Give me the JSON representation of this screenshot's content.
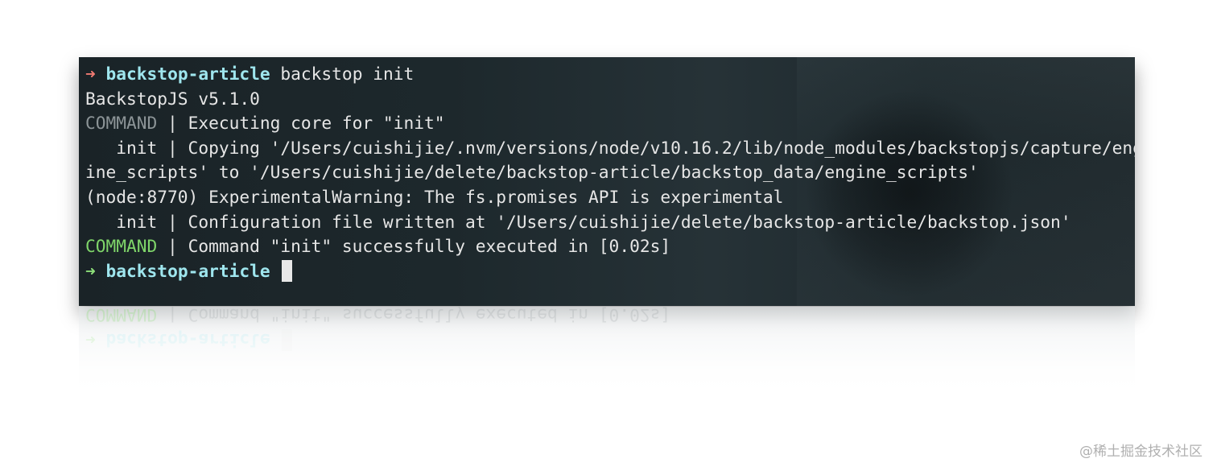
{
  "terminal": {
    "lines": [
      {
        "arrow": "➜",
        "dir": "backstop-article",
        "text": " backstop init"
      },
      {
        "text": "BackstopJS v5.1.0"
      },
      {
        "tag": "COMMAND",
        "text": " | Executing core for \"init\""
      },
      {
        "text": "   init | Copying '/Users/cuishijie/.nvm/versions/node/v10.16.2/lib/node_modules/backstopjs/capture/eng"
      },
      {
        "text": "ine_scripts' to '/Users/cuishijie/delete/backstop-article/backstop_data/engine_scripts'"
      },
      {
        "text": "(node:8770) ExperimentalWarning: The fs.promises API is experimental"
      },
      {
        "text": "   init | Configuration file written at '/Users/cuishijie/delete/backstop-article/backstop.json'"
      },
      {
        "tag": "COMMAND",
        "text": " | Command \"init\" successfully executed in [0.02s]"
      },
      {
        "arrow": "➜",
        "dir": "backstop-article",
        "text": " "
      }
    ]
  },
  "watermark": "@稀土掘金技术社区",
  "colors": {
    "arrow_error": "#f07a72",
    "arrow_ok": "#8ee07a",
    "directory": "#9fe6ee",
    "command_gray": "#8c9497",
    "command_green": "#7fd66a"
  }
}
